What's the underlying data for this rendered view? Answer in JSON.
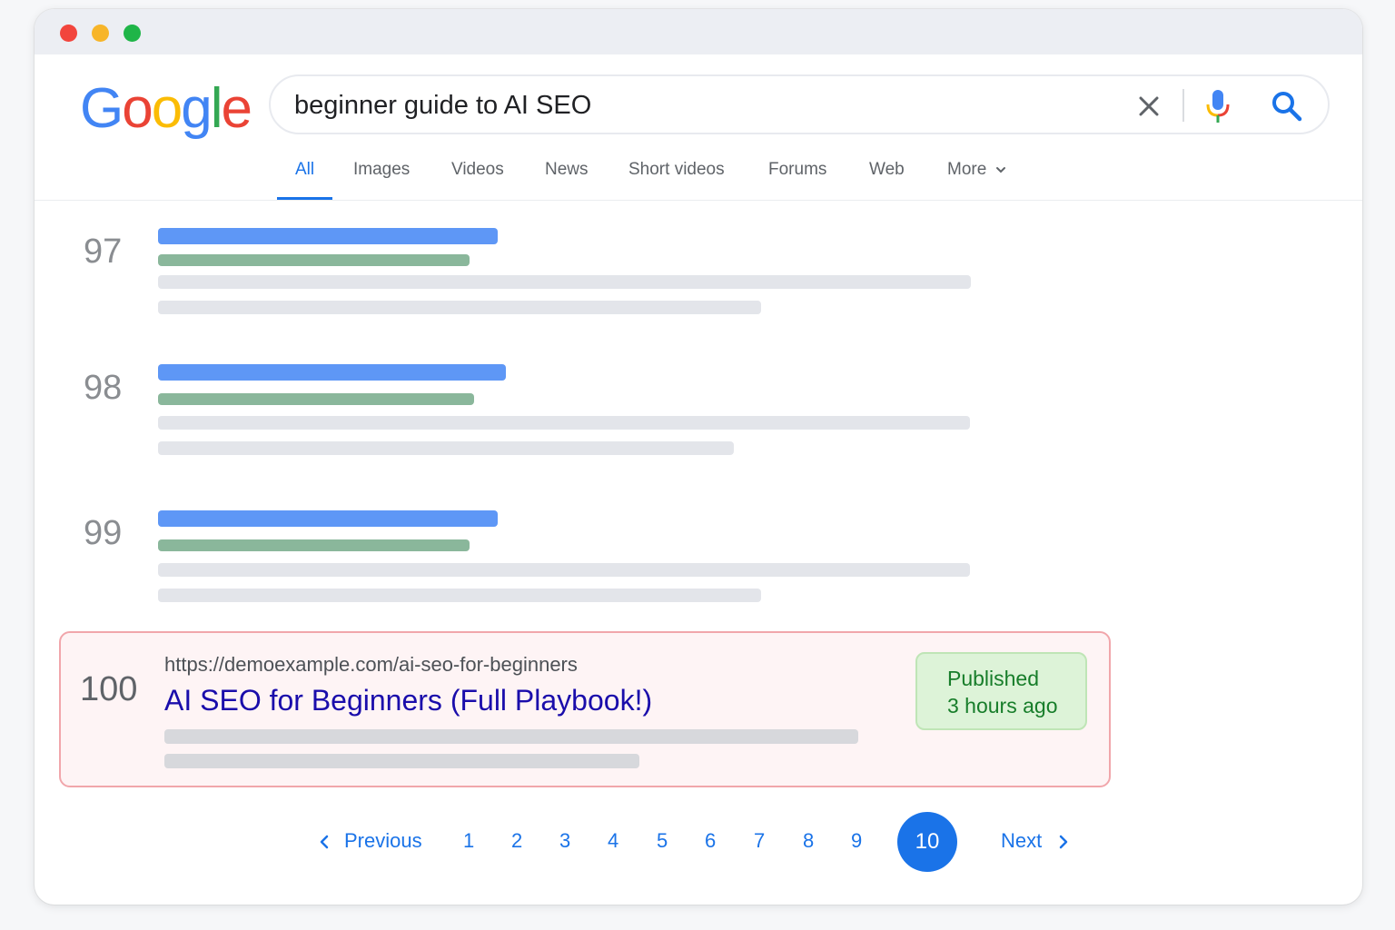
{
  "logo": {
    "letters": [
      "G",
      "o",
      "o",
      "g",
      "l",
      "e"
    ],
    "colors": [
      "#4285F4",
      "#EA4335",
      "#FBBC05",
      "#4285F4",
      "#34A853",
      "#EA4335"
    ]
  },
  "search": {
    "query": "beginner guide to AI SEO"
  },
  "icons": {
    "clear": "close-icon",
    "mic": "microphone-icon",
    "search": "search-icon"
  },
  "tabs": [
    {
      "label": "All",
      "active": true
    },
    {
      "label": "Images"
    },
    {
      "label": "Videos"
    },
    {
      "label": "News"
    },
    {
      "label": "Short videos"
    },
    {
      "label": "Forums"
    },
    {
      "label": "Web"
    },
    {
      "label": "More"
    }
  ],
  "results": [
    {
      "rank": "97"
    },
    {
      "rank": "98"
    },
    {
      "rank": "99"
    }
  ],
  "highlighted_result": {
    "rank": "100",
    "url": "https://demoexample.com/ai-seo-for-beginners",
    "title": "AI SEO for Beginners (Full Playbook!)",
    "badge_line1": "Published",
    "badge_line2": "3 hours ago"
  },
  "pagination": {
    "previous": "Previous",
    "pages": [
      "1",
      "2",
      "3",
      "4",
      "5",
      "6",
      "7",
      "8",
      "9"
    ],
    "current": "10",
    "next": "Next"
  },
  "colors": {
    "accent": "#1a73e8",
    "link": "#1a0dab",
    "highlight_border": "#f1a6ab",
    "badge_text": "#177d2a"
  }
}
